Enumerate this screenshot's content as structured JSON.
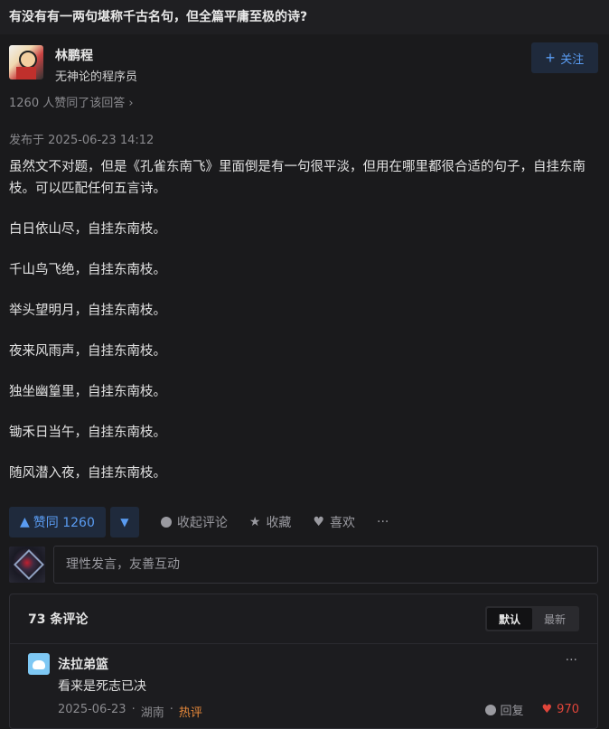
{
  "question": {
    "title": "有没有有一两句堪称千古名句，但全篇平庸至极的诗?"
  },
  "author": {
    "name": "林鹏程",
    "description": "无神论的程序员",
    "follow_label": "关注"
  },
  "answer": {
    "votes_text": "1260 人赞同了该回答",
    "published": "发布于 2025-06-23 14:12",
    "intro": "虽然文不对题，但是《孔雀东南飞》里面倒是有一句很平淡，但用在哪里都很合适的句子，自挂东南枝。可以匹配任何五言诗。",
    "lines": [
      "白日依山尽，自挂东南枝。",
      "千山鸟飞绝，自挂东南枝。",
      "举头望明月，自挂东南枝。",
      "夜来风雨声，自挂东南枝。",
      "独坐幽篁里，自挂东南枝。",
      "锄禾日当午，自挂东南枝。",
      "随风潜入夜，自挂东南枝。"
    ]
  },
  "actions": {
    "upvote_label": "赞同 1260",
    "collapse_comments": "收起评论",
    "favorite": "收藏",
    "like": "喜欢",
    "more": "···"
  },
  "comment_input": {
    "placeholder": "理性发言，友善互动"
  },
  "comments": {
    "count_label": "73 条评论",
    "sort_default": "默认",
    "sort_latest": "最新",
    "items": [
      {
        "name": "法拉弟篮",
        "text": "看来是死志已决",
        "date": "2025-06-23",
        "location": "湖南",
        "tag": "热评",
        "reply_label": "回复",
        "likes": "970"
      }
    ]
  }
}
